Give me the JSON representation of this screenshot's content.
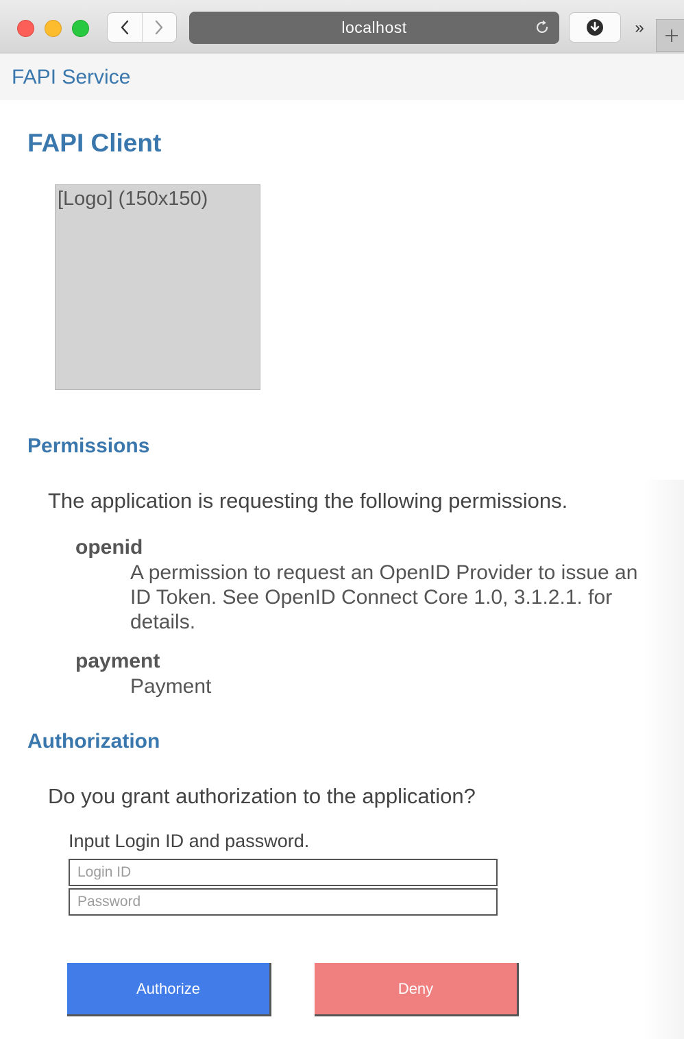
{
  "browser": {
    "url": "localhost"
  },
  "site": {
    "brand": "FAPI Service"
  },
  "client": {
    "title": "FAPI Client",
    "logo_placeholder": "[Logo] (150x150)"
  },
  "permissions": {
    "heading": "Permissions",
    "intro": "The application is requesting the following permissions.",
    "items": [
      {
        "name": "openid",
        "description": "A permission to request an OpenID Provider to issue an ID Token. See OpenID Connect Core 1.0, 3.1.2.1. for details."
      },
      {
        "name": "payment",
        "description": "Payment"
      }
    ]
  },
  "authorization": {
    "heading": "Authorization",
    "question": "Do you grant authorization to the application?",
    "instruction": "Input Login ID and password.",
    "login_placeholder": "Login ID",
    "password_placeholder": "Password",
    "authorize_label": "Authorize",
    "deny_label": "Deny"
  },
  "colors": {
    "heading": "#3a77ad",
    "authorize": "#417ce8",
    "deny": "#f08080",
    "logo_bg": "#d3d3d3"
  },
  "icons": {
    "back": "chevron-left-icon",
    "forward": "chevron-right-icon",
    "reload": "reload-icon",
    "download": "download-icon",
    "overflow": "double-chevron-icon",
    "new_tab": "plus-icon"
  }
}
